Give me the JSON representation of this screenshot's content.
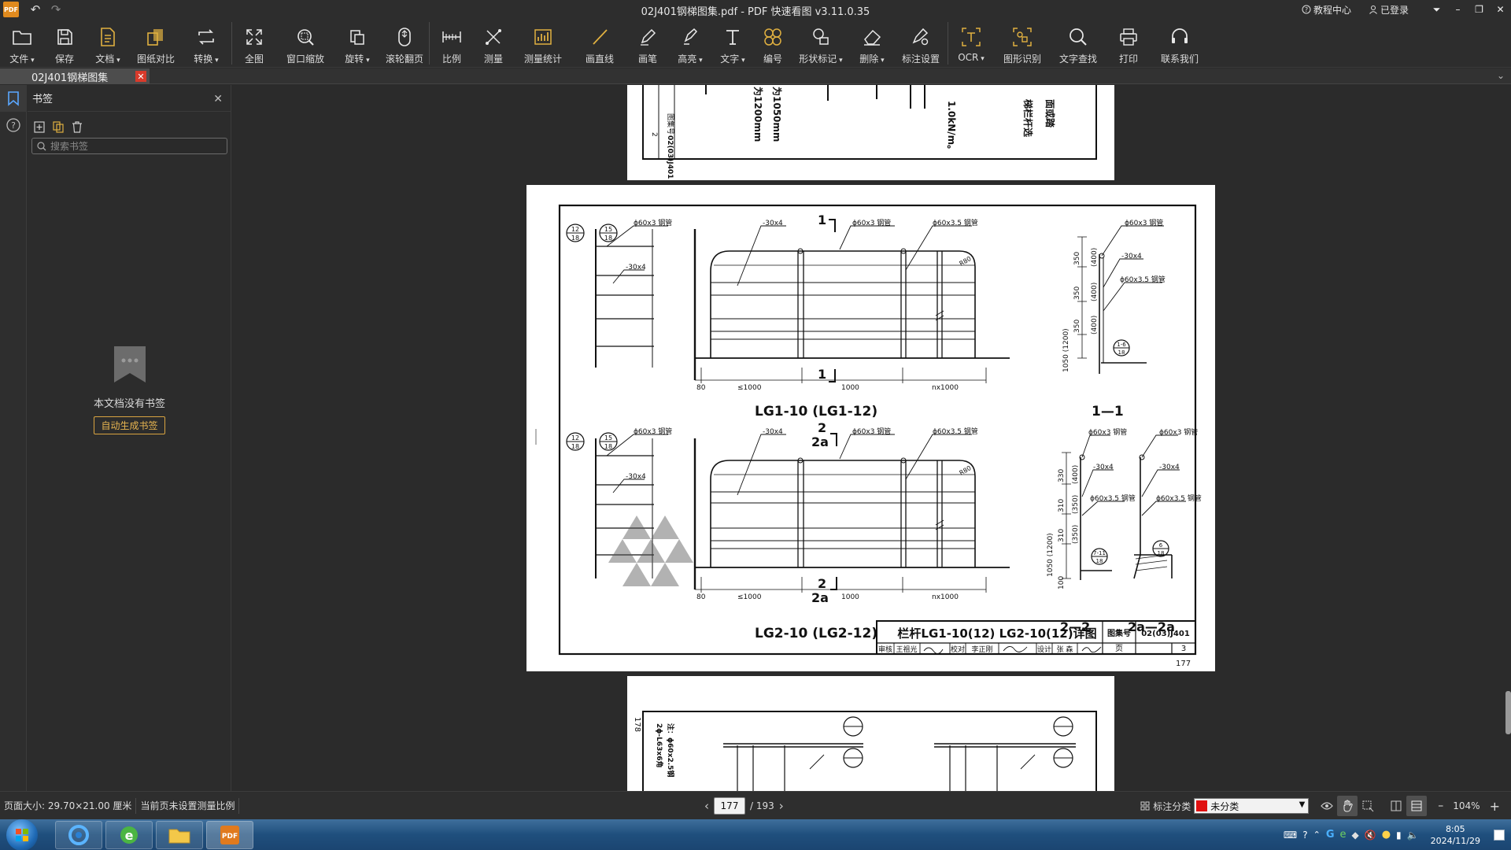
{
  "window": {
    "title": "02J401钢梯图集.pdf - PDF 快速看图 v3.11.0.35",
    "tutorial": "教程中心",
    "login": "已登录"
  },
  "toolbar": {
    "file": "文件",
    "save": "保存",
    "document": "文档",
    "compare": "图纸对比",
    "convert": "转换",
    "full": "全图",
    "window_zoom": "窗口缩放",
    "rotate": "旋转",
    "scroll_page": "滚轮翻页",
    "scale": "比例",
    "measure": "测量",
    "measure_stats": "测量统计",
    "line": "画直线",
    "pen": "画笔",
    "highlight": "高亮",
    "text": "文字",
    "number": "编号",
    "shape_mark": "形状标记",
    "delete": "删除",
    "mark_settings": "标注设置",
    "ocr": "OCR",
    "shape_recog": "图形识别",
    "text_search": "文字查找",
    "print": "打印",
    "contact": "联系我们"
  },
  "tab": {
    "label": "02J401钢梯图集"
  },
  "bookmarks": {
    "title": "书签",
    "search_placeholder": "搜索书签",
    "empty_message": "本文档没有书签",
    "auto_generate": "自动生成书签"
  },
  "drawing": {
    "main_title": "栏杆LG1-10(12) LG2-10(12)详图",
    "atlas_label": "图集号",
    "atlas_no": "02(03)J401",
    "page_label": "页",
    "page_no": "3",
    "sheet_page": "177",
    "next_sheet_page": "178",
    "title1": "LG1-10 (LG1-12)",
    "title2": "LG2-10 (LG2-12)",
    "section1": "1—1",
    "section2": "2—2",
    "section2a": "2a—2a",
    "pipe60x3": "ϕ60x3 钢管",
    "pipe60x35": "ϕ60x3.5 钢管",
    "flat": "-30x4",
    "dim_le1000": "≤1000",
    "dim_1000": "1000",
    "dim_n1000": "nx1000",
    "dim_80": "80",
    "dim_1050": "1050 (1200)",
    "dim_350": "350",
    "dim_400": "(400)",
    "dim_330": "330",
    "dim_310": "310",
    "dim_350p": "(350)",
    "dim_100": "100",
    "cut1": "1",
    "cut2": "2",
    "cut2a": "2a",
    "ref_top": "12",
    "ref_bot": "18",
    "ref_15": "15",
    "ref_1_6": "1-6",
    "ref_7_11": "7-11",
    "ref_6": "6",
    "r80": "R80",
    "sig_review": "审核",
    "sig_name1": "王祖光",
    "sig_check": "校对",
    "sig_name2": "李正刚",
    "sig_design": "设计",
    "sig_name3": "张 森",
    "note_a": "注：ϕ60x2.5钢",
    "note_b": "2ϕ-L63x6角",
    "prev_atlas": "02(03)J401",
    "prev_page": "2",
    "prev_label": "图集号",
    "prev_t1": "为1050mm",
    "prev_t2": "为1200mm",
    "prev_t3": "1.0kN/m。",
    "prev_t4": "面或踏",
    "prev_t5": "梯栏杆选"
  },
  "status": {
    "page_size": "页面大小: 29.70×21.00 厘米",
    "scale_note": "当前页未设置测量比例",
    "current_page": "177",
    "total_pages": "/ 193",
    "mark_category": "标注分类",
    "category_value": "未分类",
    "zoom": "104%"
  },
  "clock": {
    "time": "8:05",
    "date": "2024/11/29"
  },
  "colors": {
    "accent": "#e0b040",
    "close_red": "#d93a2b",
    "category_red": "#e01010"
  }
}
